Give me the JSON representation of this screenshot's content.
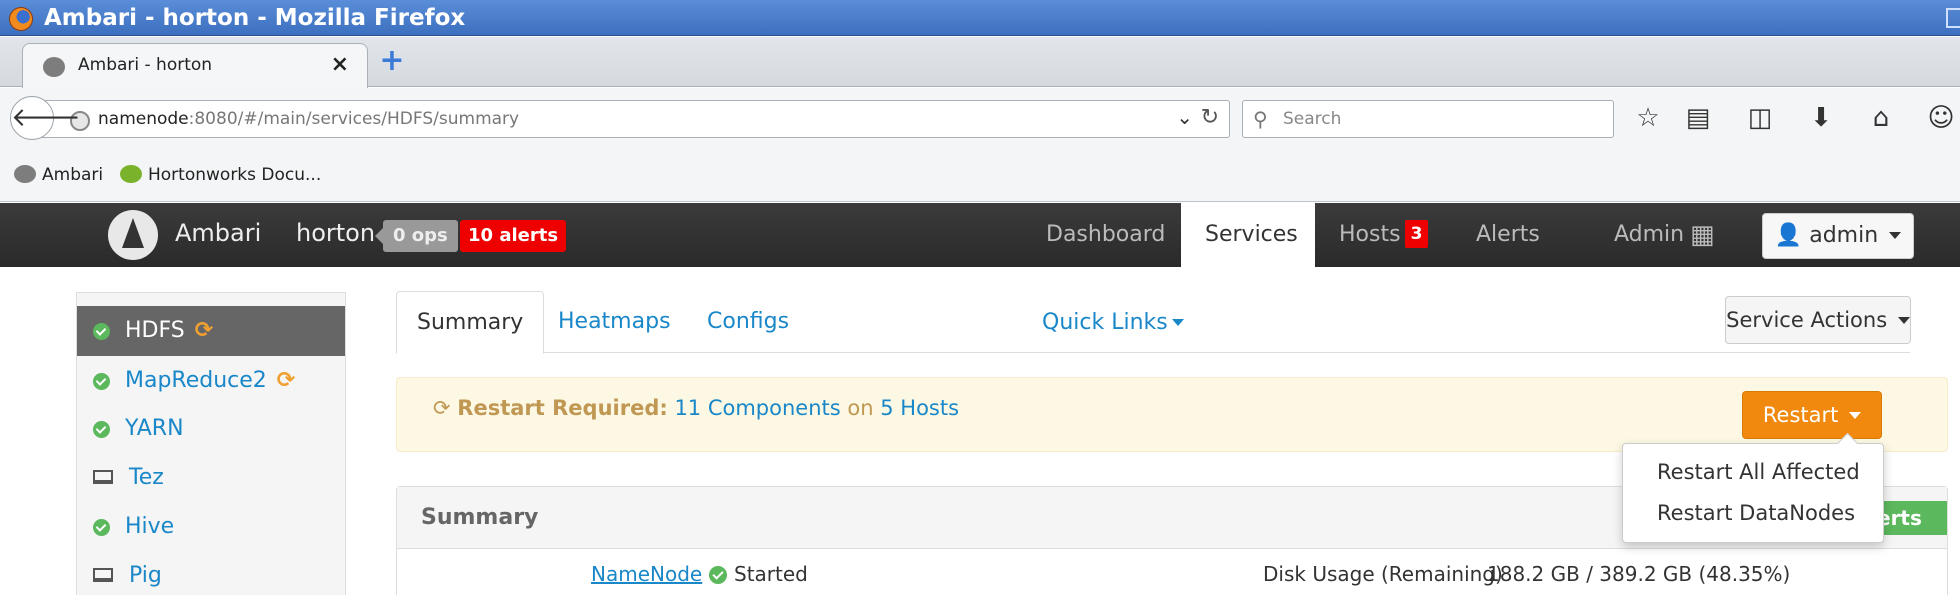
{
  "browser": {
    "window_title": "Ambari - horton - Mozilla Firefox",
    "tab_title": "Ambari - horton",
    "tab_close": "×",
    "new_tab": "+",
    "url_host": "namenode",
    "url_path": ":8080/#/main/services/HDFS/summary",
    "search_placeholder": "Search",
    "bookmarks": [
      "Ambari",
      "Hortonworks Docu..."
    ]
  },
  "ambari": {
    "brand": "Ambari",
    "cluster": "horton",
    "ops_badge": "0 ops",
    "alerts_badge": "10 alerts",
    "nav": {
      "dashboard": "Dashboard",
      "services": "Services",
      "hosts": "Hosts",
      "hosts_count": "3",
      "alerts": "Alerts",
      "admin": "Admin"
    },
    "user_button": "admin"
  },
  "sidebar": {
    "items": [
      {
        "label": "HDFS",
        "status": "started",
        "restart": true,
        "active": true
      },
      {
        "label": "MapReduce2",
        "status": "started",
        "restart": true,
        "active": false
      },
      {
        "label": "YARN",
        "status": "started",
        "restart": false,
        "active": false
      },
      {
        "label": "Tez",
        "status": "client",
        "restart": false,
        "active": false
      },
      {
        "label": "Hive",
        "status": "started",
        "restart": false,
        "active": false
      },
      {
        "label": "Pig",
        "status": "client",
        "restart": false,
        "active": false
      }
    ]
  },
  "main": {
    "tabs": [
      "Summary",
      "Heatmaps",
      "Configs"
    ],
    "quick_links": "Quick Links",
    "service_actions": "Service Actions",
    "restart_bar": {
      "label": "Restart Required:",
      "components": "11 Components",
      "on": "on",
      "hosts": "5 Hosts",
      "button": "Restart"
    },
    "restart_menu": [
      "Restart All Affected",
      "Restart DataNodes"
    ],
    "summary": {
      "title": "Summary",
      "alerts_button": "erts",
      "namenode_link": "NameNode",
      "namenode_status": "Started",
      "disk_label": "Disk Usage (Remaining)",
      "disk_value": "188.2 GB / 389.2 GB (48.35%)"
    }
  },
  "colors": {
    "link": "#1a87c9",
    "alert_red": "#ee0000",
    "restart_orange": "#f0890e",
    "success_green": "#5cb85c"
  }
}
